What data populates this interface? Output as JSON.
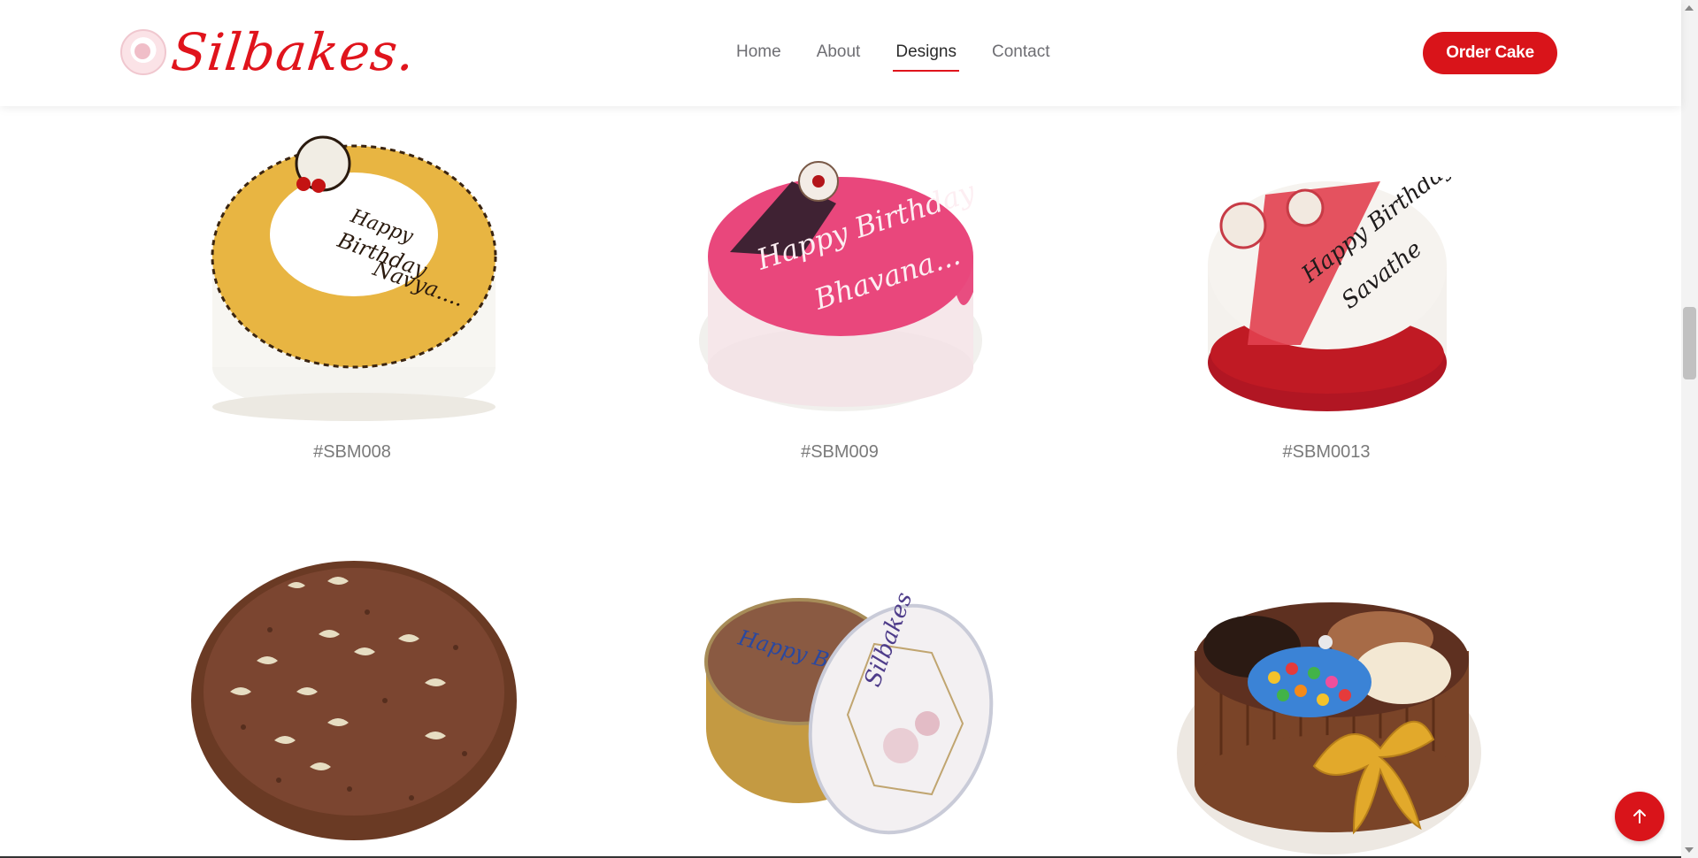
{
  "brand": {
    "name": "Silbakes."
  },
  "nav": {
    "items": [
      {
        "label": "Home",
        "active": false
      },
      {
        "label": "About",
        "active": false
      },
      {
        "label": "Designs",
        "active": true
      },
      {
        "label": "Contact",
        "active": false
      }
    ]
  },
  "cta": {
    "order_label": "Order Cake"
  },
  "designs": [
    {
      "code": "#SBM008"
    },
    {
      "code": "#SBM009"
    },
    {
      "code": "#SBM0013"
    },
    {
      "code": ""
    },
    {
      "code": ""
    },
    {
      "code": ""
    }
  ],
  "colors": {
    "accent": "#d9141a",
    "nav_text": "#6e6e73",
    "code_text": "#7a7a7a"
  },
  "icons": {
    "back_to_top": "arrow-up-icon"
  }
}
